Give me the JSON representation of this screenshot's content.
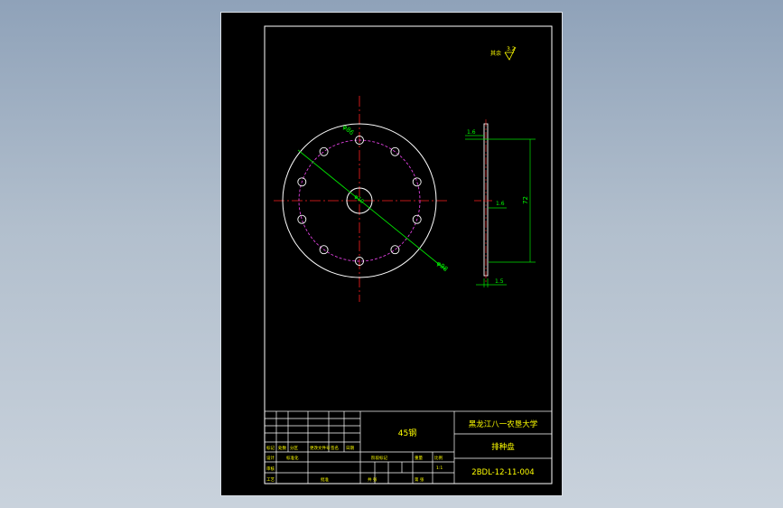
{
  "drawing": {
    "material_cell": "45钢",
    "university": "黑龙江八一农垦大学",
    "part_name": "排种盘",
    "drawing_number": "2BDL-12-11-004",
    "roughness_note": "其余",
    "roughness_value": "3.2",
    "dim_diameter_outer": "φ98",
    "dim_diameter_hole": "φ10",
    "dim_hole_circle": "φ86",
    "dim_tol_top": "1.6",
    "dim_tol_mid": "1.6",
    "dim_tol_bottom": "1.5",
    "dim_height": "72",
    "tb_scale_label": "比例",
    "tb_weight_label": "重量",
    "tb_design_label": "设计",
    "tb_check_label": "审核",
    "tb_approve_label": "批准",
    "tb_mark_label": "标记",
    "tb_count_label": "处数",
    "tb_zone_label": "分区",
    "tb_change_label": "更改文件号",
    "tb_sign_label": "签名",
    "tb_date_label": "日期",
    "tb_sheet_label": "共 张",
    "tb_sheet_num_label": "第 张",
    "tb_stage_label": "阶段标记",
    "tb_scale_value": "1:1",
    "tb_craft_label": "工艺",
    "tb_std_label": "标准化"
  },
  "colors": {
    "line": "#ffffff",
    "center": "#ff2020",
    "dim": "#00e000",
    "dim_text": "#00ff00",
    "hidden": "#e040e0",
    "text": "#ffff00"
  }
}
